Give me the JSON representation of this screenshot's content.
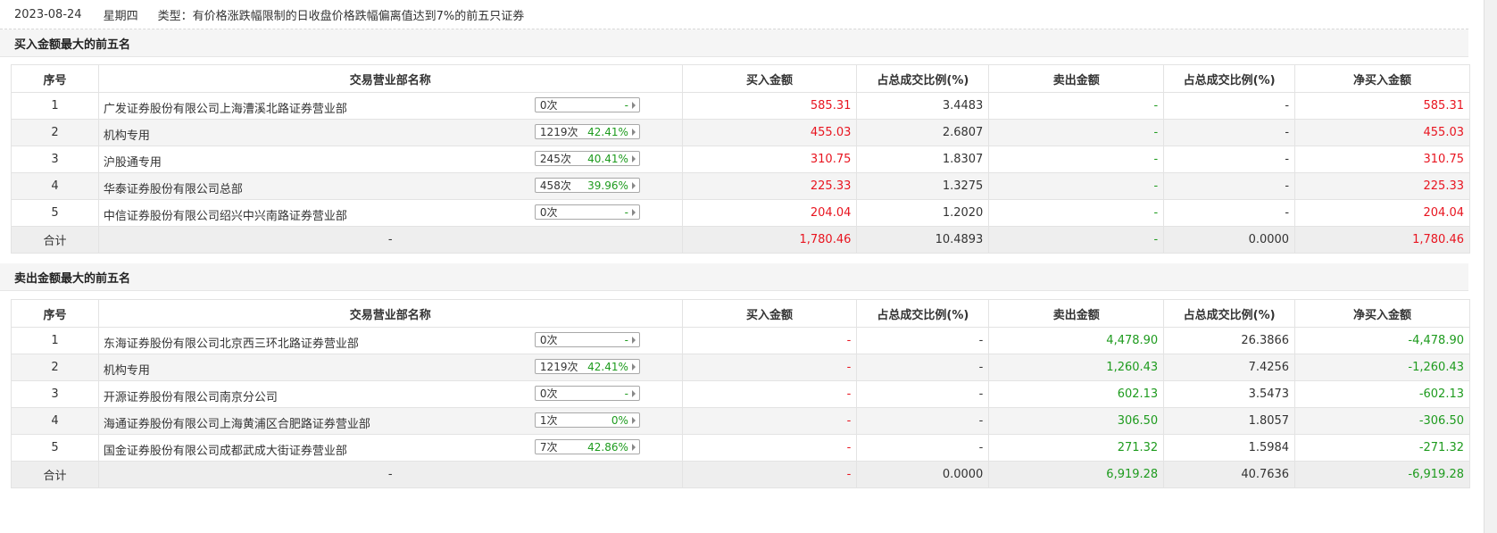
{
  "header": {
    "date": "2023-08-24",
    "weekday": "星期四",
    "type_text": "类型：有价格涨跌幅限制的日收盘价格跌幅偏离值达到7%的前五只证券"
  },
  "columns": {
    "seq": "序号",
    "name": "交易营业部名称",
    "buy": "买入金额",
    "buy_ratio": "占总成交比例(%)",
    "sell": "卖出金额",
    "sell_ratio": "占总成交比例(%)",
    "net": "净买入金额"
  },
  "buy_section": {
    "title": "买入金额最大的前五名",
    "rows": [
      {
        "seq": "1",
        "name": "广发证券股份有限公司上海漕溪北路证券营业部",
        "count": "0次",
        "rate": "-",
        "buy": "585.31",
        "buy_ratio": "3.4483",
        "sell": "-",
        "sell_ratio": "-",
        "net": "585.31"
      },
      {
        "seq": "2",
        "name": "机构专用",
        "count": "1219次",
        "rate": "42.41%",
        "buy": "455.03",
        "buy_ratio": "2.6807",
        "sell": "-",
        "sell_ratio": "-",
        "net": "455.03"
      },
      {
        "seq": "3",
        "name": "沪股通专用",
        "count": "245次",
        "rate": "40.41%",
        "buy": "310.75",
        "buy_ratio": "1.8307",
        "sell": "-",
        "sell_ratio": "-",
        "net": "310.75"
      },
      {
        "seq": "4",
        "name": "华泰证券股份有限公司总部",
        "count": "458次",
        "rate": "39.96%",
        "buy": "225.33",
        "buy_ratio": "1.3275",
        "sell": "-",
        "sell_ratio": "-",
        "net": "225.33"
      },
      {
        "seq": "5",
        "name": "中信证券股份有限公司绍兴中兴南路证券营业部",
        "count": "0次",
        "rate": "-",
        "buy": "204.04",
        "buy_ratio": "1.2020",
        "sell": "-",
        "sell_ratio": "-",
        "net": "204.04"
      }
    ],
    "total": {
      "label": "合计",
      "name": "-",
      "buy": "1,780.46",
      "buy_ratio": "10.4893",
      "sell": "-",
      "sell_ratio": "0.0000",
      "net": "1,780.46"
    }
  },
  "sell_section": {
    "title": "卖出金额最大的前五名",
    "rows": [
      {
        "seq": "1",
        "name": "东海证券股份有限公司北京西三环北路证券营业部",
        "count": "0次",
        "rate": "-",
        "buy": "-",
        "buy_ratio": "-",
        "sell": "4,478.90",
        "sell_ratio": "26.3866",
        "net": "-4,478.90"
      },
      {
        "seq": "2",
        "name": "机构专用",
        "count": "1219次",
        "rate": "42.41%",
        "buy": "-",
        "buy_ratio": "-",
        "sell": "1,260.43",
        "sell_ratio": "7.4256",
        "net": "-1,260.43"
      },
      {
        "seq": "3",
        "name": "开源证券股份有限公司南京分公司",
        "count": "0次",
        "rate": "-",
        "buy": "-",
        "buy_ratio": "-",
        "sell": "602.13",
        "sell_ratio": "3.5473",
        "net": "-602.13"
      },
      {
        "seq": "4",
        "name": "海通证券股份有限公司上海黄浦区合肥路证券营业部",
        "count": "1次",
        "rate": "0%",
        "buy": "-",
        "buy_ratio": "-",
        "sell": "306.50",
        "sell_ratio": "1.8057",
        "net": "-306.50"
      },
      {
        "seq": "5",
        "name": "国金证券股份有限公司成都武成大街证券营业部",
        "count": "7次",
        "rate": "42.86%",
        "buy": "-",
        "buy_ratio": "-",
        "sell": "271.32",
        "sell_ratio": "1.5984",
        "net": "-271.32"
      }
    ],
    "total": {
      "label": "合计",
      "name": "-",
      "buy": "-",
      "buy_ratio": "0.0000",
      "sell": "6,919.28",
      "sell_ratio": "40.7636",
      "net": "-6,919.28"
    }
  },
  "colors": {
    "positive": "#e8141f",
    "negative": "#1e9b1e"
  }
}
